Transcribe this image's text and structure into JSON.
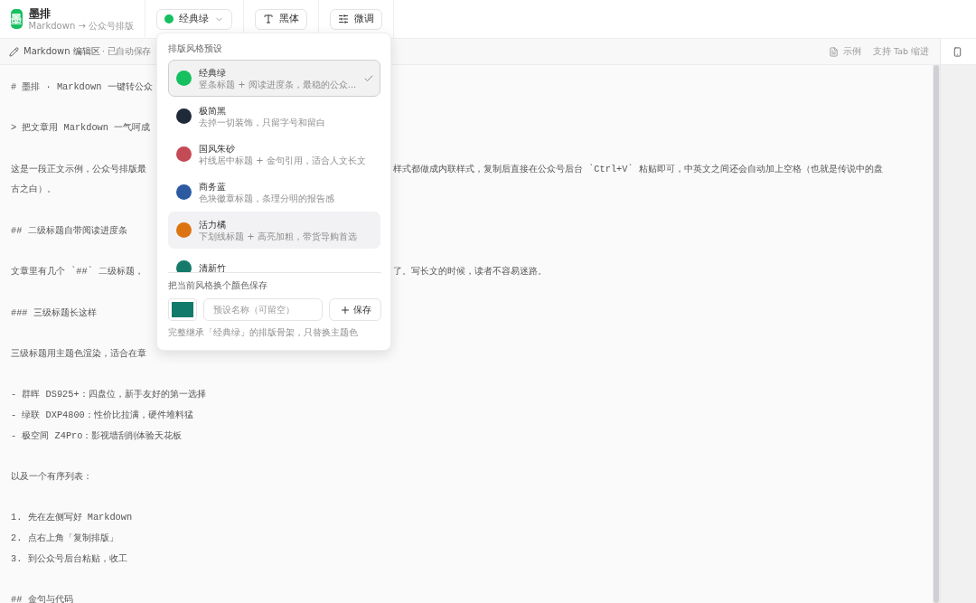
{
  "app": {
    "name": "墨排",
    "logo": "墨",
    "subtitle": "Markdown → 公众号排版"
  },
  "toolbar": [
    {
      "kind": "theme",
      "label": "经典绿",
      "color": "#16c060",
      "expanded": true
    },
    {
      "kind": "font",
      "label": "黑体"
    },
    {
      "kind": "tune",
      "label": "微调"
    }
  ],
  "editor_bar": {
    "title": "Markdown 编辑区",
    "status": "· 已自动保存",
    "example": "示例",
    "hint": "支持 Tab 缩进"
  },
  "editor": [
    [
      {
        "text": "# 墨排 · Markdown 一键转公众"
      }
    ],
    [
      {
        "text": "> 把文章用 Markdown 一气呵成"
      }
    ],
    [
      {
        "text": "这是一段正文示例，公众号排版最",
        "tail": "样式都做成内联样式，复制后直接在公众号后台 `Ctrl+V` 粘贴即可，中英文之间还会自动加上空格（也就是传说中的盘"
      },
      {
        "text": "古之白）。"
      }
    ],
    [
      {
        "text": "## 二级标题自带阅读进度条"
      }
    ],
    [
      {
        "text": "文章里有几个 `##` 二级标题，",
        "tail": "了。写长文的时候，读者不容易迷路。"
      }
    ],
    [
      {
        "text": "### 三级标题长这样"
      }
    ],
    [
      {
        "text": "三级标题用主题色渲染，适合在章"
      }
    ],
    [
      {
        "text": "- 群晖 DS925+：四盘位，新手友好的第一选择"
      },
      {
        "text": "- 绿联 DXP4800：性价比拉满，硬件堆料猛"
      },
      {
        "text": "- 极空间 Z4Pro：影视墙刮削体验天花板"
      }
    ],
    [
      {
        "text": "以及一个有序列表："
      }
    ],
    [
      {
        "text": "1. 先在左侧写好 Markdown"
      },
      {
        "text": "2. 点右上角「复制排版」"
      },
      {
        "text": "3. 到公众号后台粘贴，收工"
      }
    ],
    [
      {
        "text": "## 金句与代码"
      }
    ]
  ],
  "preset_menu": {
    "title": "排版风格预设",
    "presets": [
      {
        "name": "经典绿",
        "desc": "竖条标题 + 阅读进度条，最稳的公众...",
        "color": "#16c060",
        "selected": true,
        "highlighted": false
      },
      {
        "name": "极简黑",
        "desc": "去掉一切装饰，只留字号和留白",
        "color": "#1e2a3a",
        "selected": false,
        "highlighted": false
      },
      {
        "name": "国风朱砂",
        "desc": "衬线居中标题 + 金句引用，适合人文长文",
        "color": "#c44a55",
        "selected": false,
        "highlighted": false
      },
      {
        "name": "商务蓝",
        "desc": "色块徽章标题，条理分明的报告感",
        "color": "#2b5aa0",
        "selected": false,
        "highlighted": false
      },
      {
        "name": "活力橘",
        "desc": "下划线标题 + 高亮加粗，带货导购首选",
        "color": "#dc7412",
        "selected": false,
        "highlighted": true
      },
      {
        "name": "清新竹",
        "color": "#167a6a",
        "selected": false,
        "highlighted": false
      }
    ],
    "save_title": "把当前风格换个颜色保存",
    "custom_color": {
      "color": "#127a6a"
    },
    "name_placeholder": "预设名称（可留空）",
    "save_button": "保存",
    "note": "完整继承「经典绿」的排版骨架，只替换主题色"
  }
}
